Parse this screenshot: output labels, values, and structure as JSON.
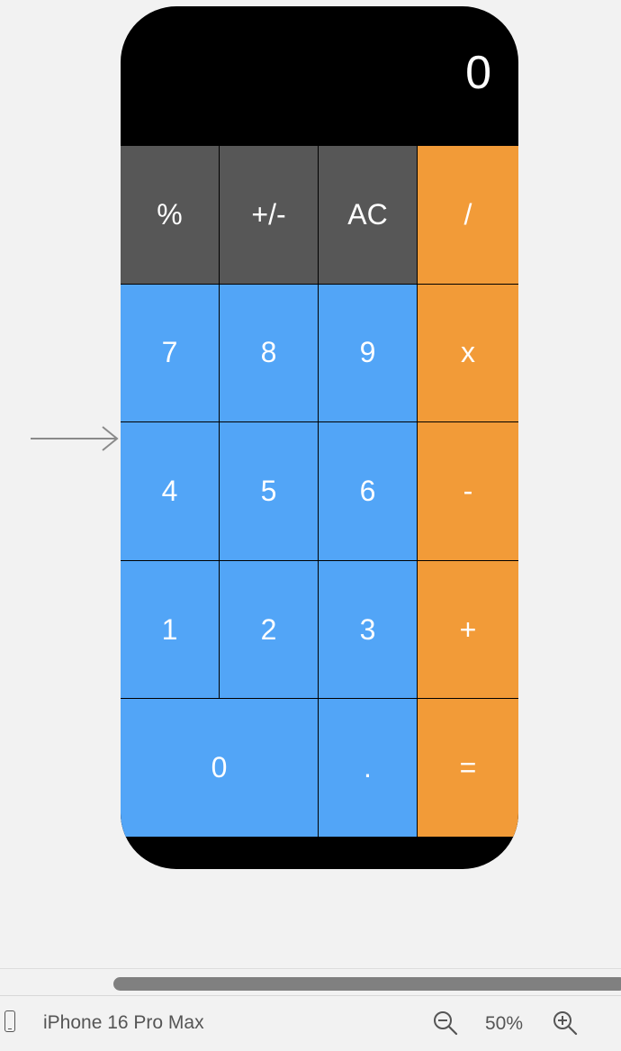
{
  "display": {
    "value": "0"
  },
  "keys": [
    {
      "label": "%",
      "kind": "func"
    },
    {
      "label": "+/-",
      "kind": "func"
    },
    {
      "label": "AC",
      "kind": "func"
    },
    {
      "label": "/",
      "kind": "op"
    },
    {
      "label": "7",
      "kind": "num"
    },
    {
      "label": "8",
      "kind": "num"
    },
    {
      "label": "9",
      "kind": "num"
    },
    {
      "label": "x",
      "kind": "op"
    },
    {
      "label": "4",
      "kind": "num"
    },
    {
      "label": "5",
      "kind": "num"
    },
    {
      "label": "6",
      "kind": "num"
    },
    {
      "label": "-",
      "kind": "op"
    },
    {
      "label": "1",
      "kind": "num"
    },
    {
      "label": "2",
      "kind": "num"
    },
    {
      "label": "3",
      "kind": "num"
    },
    {
      "label": "+",
      "kind": "op"
    },
    {
      "label": "0",
      "kind": "num"
    },
    {
      "label": ".",
      "kind": "num"
    },
    {
      "label": "=",
      "kind": "op"
    }
  ],
  "colors": {
    "function_key": "#575757",
    "number_key": "#52a5f7",
    "operator_key": "#f29b38",
    "display_bg": "#000000"
  },
  "bottom_bar": {
    "device_icon": "iphone-icon",
    "device_name": "iPhone 16 Pro Max",
    "zoom_out_icon": "zoom-out-icon",
    "zoom_level": "50%",
    "zoom_in_icon": "zoom-in-icon"
  }
}
